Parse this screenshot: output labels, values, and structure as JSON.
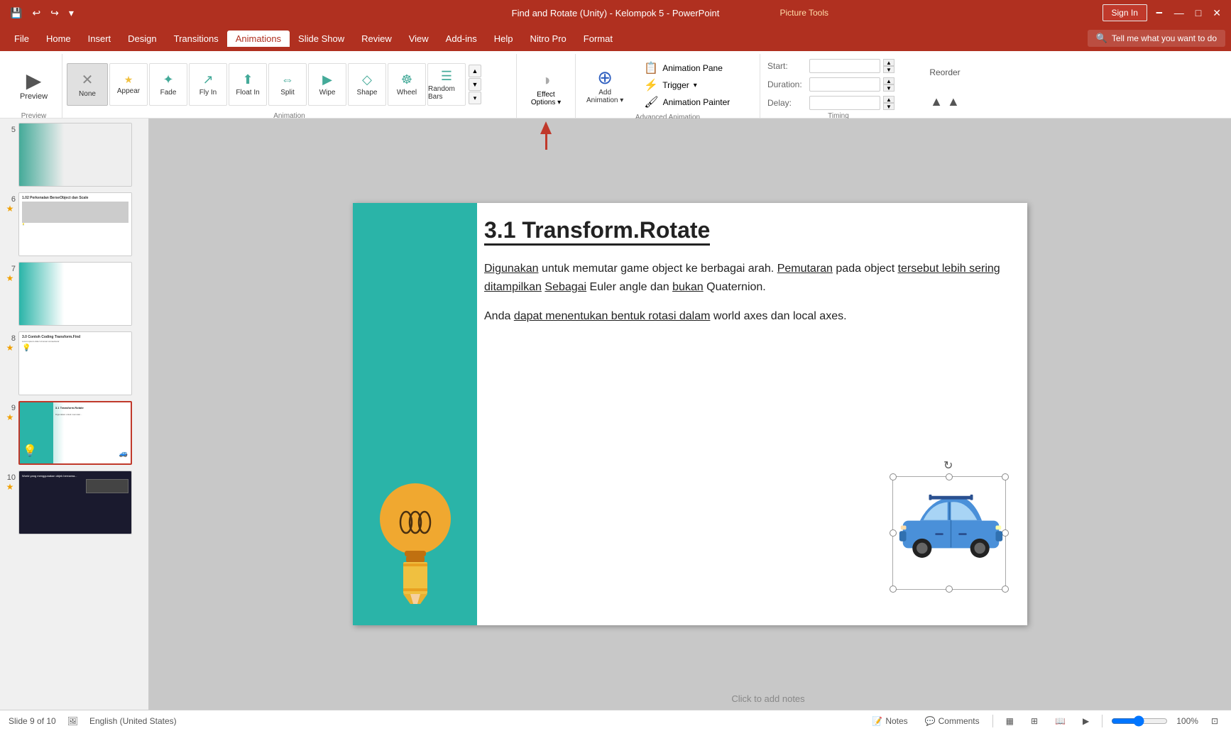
{
  "titlebar": {
    "title": "Find and Rotate (Unity) - Kelompok 5 - PowerPoint",
    "picture_tools": "Picture Tools",
    "sign_in": "Sign In"
  },
  "menubar": {
    "items": [
      "File",
      "Home",
      "Insert",
      "Design",
      "Transitions",
      "Animations",
      "Slide Show",
      "Review",
      "View",
      "Add-ins",
      "Help",
      "Nitro Pro",
      "Format"
    ],
    "active": "Animations",
    "tell_me": "Tell me what you want to do"
  },
  "ribbon": {
    "preview_label": "Preview",
    "animation_label": "Animation",
    "none": "None",
    "appear": "Appear",
    "fade": "Fade",
    "fly_in": "Fly In",
    "float_in": "Float In",
    "split": "Split",
    "wipe": "Wipe",
    "shape": "Shape",
    "wheel": "Wheel",
    "random_bars": "Random Bars",
    "effect_options": "Effect Options",
    "add_animation": "Add Animation",
    "advanced_animation_label": "Advanced Animation",
    "animation_pane": "Animation Pane",
    "trigger": "Trigger",
    "animation_painter": "Animation Painter",
    "timing_label": "Timing",
    "start": "Start:",
    "duration": "Duration:",
    "delay": "Delay:",
    "reorder": "Reorder"
  },
  "slides": [
    {
      "num": "5",
      "has_star": false
    },
    {
      "num": "6",
      "has_star": true
    },
    {
      "num": "7",
      "has_star": true
    },
    {
      "num": "8",
      "has_star": true
    },
    {
      "num": "9",
      "has_star": true,
      "active": true
    },
    {
      "num": "10",
      "has_star": true
    }
  ],
  "slide": {
    "title": "3.1 Transform.Rotate",
    "body1": "Digunakan untuk memutar game object ke berbagai arah. Pemutaran pada object tersebut lebih sering ditampilkan Sebagai Euler angle dan bukan Quaternion.",
    "body2": "Anda dapat menentukan bentuk rotasi dalam world axes dan local axes."
  },
  "statusbar": {
    "slide_info": "Slide 9 of 10",
    "language": "English (United States)",
    "notes": "Notes",
    "comments": "Comments",
    "add_notes": "Click to add notes"
  }
}
